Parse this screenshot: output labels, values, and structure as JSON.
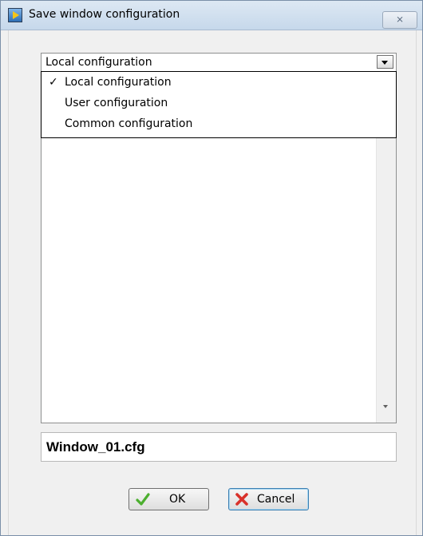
{
  "window": {
    "title": "Save window configuration",
    "close_glyph": "⨯"
  },
  "config_combo": {
    "selected_value": "Local configuration",
    "options": [
      {
        "label": "Local configuration",
        "checked": true
      },
      {
        "label": "User configuration",
        "checked": false
      },
      {
        "label": "Common configuration",
        "checked": false
      }
    ],
    "check_glyph": "✓"
  },
  "filename": {
    "value": "Window_01.cfg"
  },
  "buttons": {
    "ok_label": "OK",
    "cancel_label": "Cancel"
  },
  "icons": {
    "app": "labview-app-icon",
    "ok": "green-checkmark-icon",
    "cancel": "red-x-icon",
    "combo_arrow": "chevron-down-icon",
    "close": "close-icon"
  },
  "colors": {
    "titlebar_top": "#dde8f3",
    "titlebar_bottom": "#c6d8eb",
    "dialog_bg": "#f0f0f0",
    "ok_check": "#4caf2f",
    "cancel_x": "#d9322b"
  }
}
